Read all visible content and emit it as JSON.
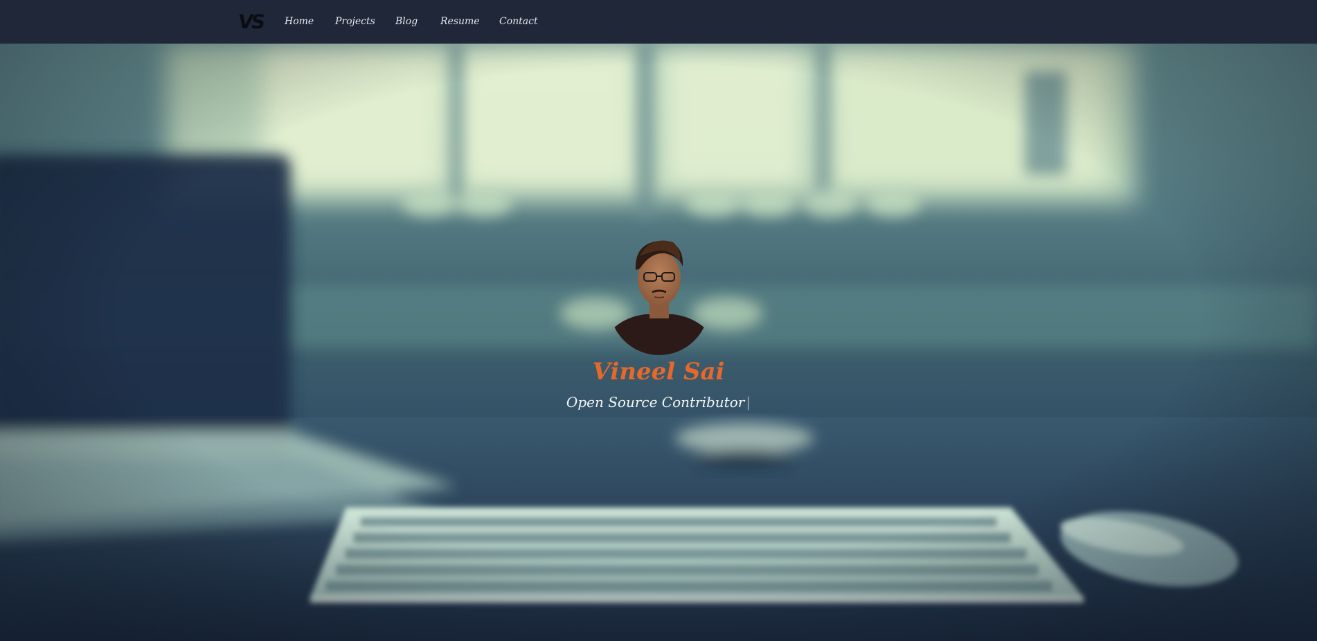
{
  "nav": {
    "logo": "VS",
    "links": [
      {
        "label": "Home"
      },
      {
        "label": "Projects"
      },
      {
        "label": "Blog"
      },
      {
        "label": "Resume"
      },
      {
        "label": "Contact"
      }
    ]
  },
  "hero": {
    "name": "Vineel Sai",
    "tagline": "Open Source Contributor",
    "cursor": "|",
    "avatar_icon": "profile-photo",
    "background_scene": "desk-with-laptop-keyboard-mouse"
  },
  "colors": {
    "navbar": "#1f2738",
    "name_accent": "#e8672a",
    "nav_text": "#e6e9ee",
    "tagline_text": "#f4f6f8"
  }
}
